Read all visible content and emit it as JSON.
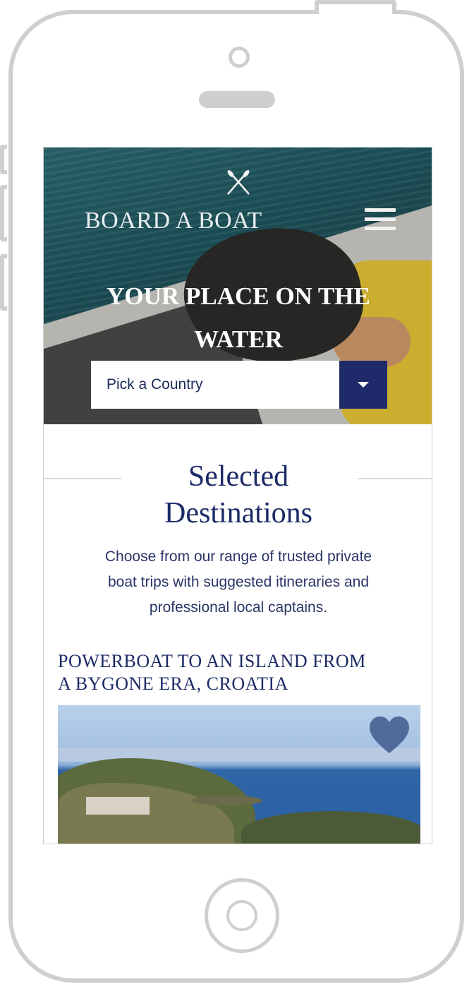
{
  "brand": {
    "name": "BOARD A BOAT",
    "logo_icon": "crossed-oars-icon"
  },
  "header": {
    "menu_icon": "hamburger-icon"
  },
  "hero": {
    "headline_line1": "YOUR PLACE ON THE",
    "headline_line2": "WATER",
    "country_select": {
      "placeholder": "Pick a Country",
      "icon": "chevron-down-icon"
    }
  },
  "section": {
    "title_line1": "Selected",
    "title_line2": "Destinations",
    "desc_line1": "Choose from our range of trusted private",
    "desc_line2": "boat trips with suggested itineraries and",
    "desc_line3": "professional local captains."
  },
  "card": {
    "title_line1": "POWERBOAT TO AN ISLAND FROM",
    "title_line2": "A BYGONE ERA, CROATIA",
    "favorite_icon": "heart-icon"
  },
  "colors": {
    "navy": "#1c2a66",
    "select_button": "#1f2a6b",
    "frame": "#cfcfcf"
  }
}
